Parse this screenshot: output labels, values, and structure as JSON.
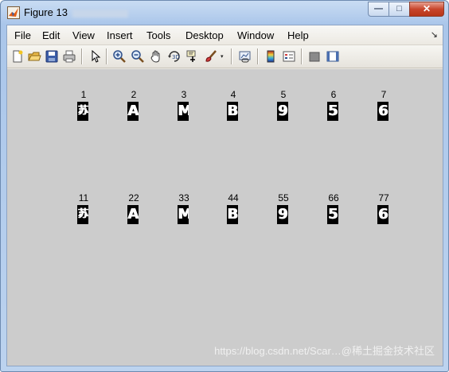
{
  "window": {
    "title": "Figure 13",
    "buttons": {
      "minimize": "—",
      "maximize": "□",
      "close": "✕"
    }
  },
  "menubar": {
    "items": [
      "File",
      "Edit",
      "View",
      "Insert",
      "Tools",
      "Desktop",
      "Window",
      "Help"
    ],
    "overflow_arrow": "↘"
  },
  "toolbar": {
    "icons": [
      "new-figure-icon",
      "open-icon",
      "save-icon",
      "print-icon",
      "pointer-icon",
      "zoom-in-icon",
      "zoom-out-icon",
      "pan-hand-icon",
      "rotate-3d-icon",
      "data-cursor-icon",
      "brush-icon",
      "link-plot-icon",
      "colorbar-icon",
      "legend-icon",
      "hide-plot-tools-icon",
      "show-plot-tools-icon"
    ],
    "dropdown_arrow": "▾"
  },
  "figure": {
    "background": "#cccccc",
    "row1": [
      {
        "label": "1",
        "glyph": "苏"
      },
      {
        "label": "2",
        "glyph": "A"
      },
      {
        "label": "3",
        "glyph": "M"
      },
      {
        "label": "4",
        "glyph": "B"
      },
      {
        "label": "5",
        "glyph": "9"
      },
      {
        "label": "6",
        "glyph": "5"
      },
      {
        "label": "7",
        "glyph": "6"
      }
    ],
    "row2": [
      {
        "label": "11",
        "glyph": "苏"
      },
      {
        "label": "22",
        "glyph": "A"
      },
      {
        "label": "33",
        "glyph": "M"
      },
      {
        "label": "44",
        "glyph": "B"
      },
      {
        "label": "55",
        "glyph": "9"
      },
      {
        "label": "66",
        "glyph": "5"
      },
      {
        "label": "77",
        "glyph": "6"
      }
    ]
  },
  "watermark": "https://blog.csdn.net/Scar…@稀土掘金技术社区"
}
